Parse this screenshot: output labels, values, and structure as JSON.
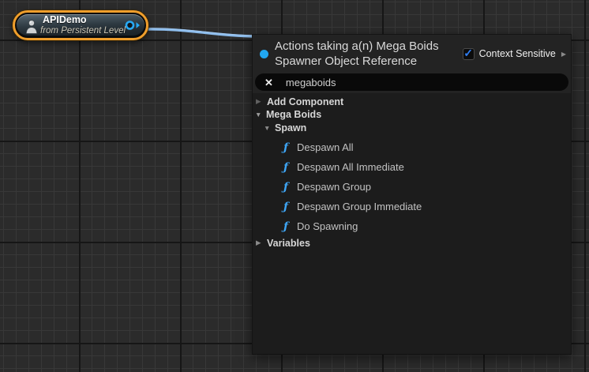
{
  "node": {
    "title": "APIDemo",
    "subtitle": "from Persistent Level",
    "icon": "pawn-icon",
    "selection_color": "#ef9e2c",
    "pin_color": "#27a9f4",
    "wire_color": "#8cbcec"
  },
  "menu": {
    "title_line1": "Actions taking a(n) Mega Boids",
    "title_line2": "Spawner Object Reference",
    "context_sensitive": {
      "label": "Context Sensitive",
      "checked": true
    },
    "search": {
      "value": "megaboids"
    },
    "tree": [
      {
        "label": "Add Component",
        "level": 0,
        "type": "category",
        "state": "collapsed"
      },
      {
        "label": "Mega Boids",
        "level": 0,
        "type": "category",
        "state": "expanded"
      },
      {
        "label": "Spawn",
        "level": 1,
        "type": "category",
        "state": "expanded"
      },
      {
        "label": "Despawn All",
        "level": 2,
        "type": "function"
      },
      {
        "label": "Despawn All Immediate",
        "level": 2,
        "type": "function"
      },
      {
        "label": "Despawn Group",
        "level": 2,
        "type": "function"
      },
      {
        "label": "Despawn Group Immediate",
        "level": 2,
        "type": "function"
      },
      {
        "label": "Do Spawning",
        "level": 2,
        "type": "function"
      },
      {
        "label": "Variables",
        "level": 0,
        "type": "category",
        "state": "collapsed"
      }
    ]
  },
  "icons": {
    "collapsed_arrow": "▶",
    "expanded_arrow": "▼",
    "function_glyph": "ƒ",
    "clear_glyph": "✕",
    "check_glyph": "✓",
    "submenu_arrow": "▶"
  },
  "colors": {
    "background": "#2b2b2b",
    "grid_minor": "#383838",
    "grid_major": "#161616",
    "panel_header": "#232323",
    "panel_body": "#1c1c1c",
    "search_bg": "#090909",
    "accent_blue": "#21a7f1",
    "function_blue": "#3ea6f6",
    "selection_orange": "#ef9e2c"
  }
}
